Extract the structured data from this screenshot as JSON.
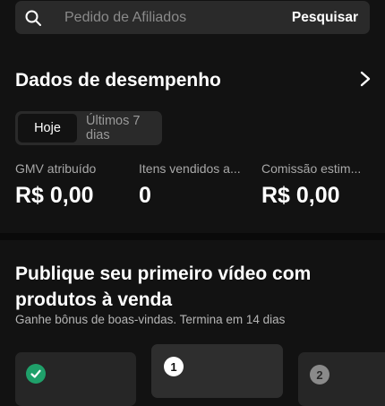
{
  "search": {
    "placeholder": "Pedido de Afiliados",
    "submit_label": "Pesquisar"
  },
  "performance": {
    "title": "Dados de desempenho",
    "periods": [
      {
        "label": "Hoje",
        "selected": true
      },
      {
        "label": "Últimos 7 dias",
        "selected": false
      }
    ],
    "metrics": [
      {
        "label": "GMV atribuído",
        "value": "R$ 0,00"
      },
      {
        "label": "Itens vendidos a...",
        "value": "0"
      },
      {
        "label": "Comissão estim...",
        "value": "R$ 0,00"
      }
    ]
  },
  "promo": {
    "title": "Publique seu primeiro vídeo com produtos à venda",
    "subtitle": "Ganhe bônus de boas-vindas. Termina em 14 dias",
    "steps": [
      {
        "status": "done",
        "number": ""
      },
      {
        "status": "current",
        "number": "1"
      },
      {
        "status": "pending",
        "number": "2"
      }
    ]
  },
  "colors": {
    "background": "#121212",
    "surface": "#2a2a2a",
    "success": "#1fa06a",
    "muted_text": "#a8a8a8"
  }
}
